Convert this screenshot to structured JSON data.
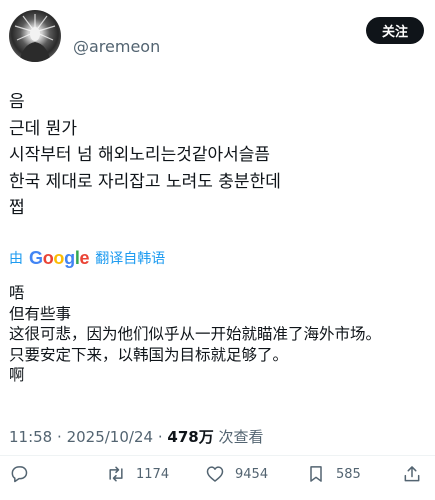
{
  "header": {
    "handle": "@aremeon",
    "follow_label": "关注"
  },
  "original": {
    "lines": [
      "음",
      "근데 뭔가",
      "시작부터 넘 해외노리는것같아서슬픔",
      "한국 제대로 자리잡고 노려도 충분한데",
      "쩝"
    ]
  },
  "translation": {
    "by_label": "由",
    "provider": "Google",
    "action_label": "翻译自韩语",
    "lines": [
      "唔",
      "但有些事",
      "这很可悲，因为他们似乎从一开始就瞄准了海外市场。",
      "只要安定下来，以韩国为目标就足够了。",
      "啊"
    ]
  },
  "meta": {
    "time": "11:58",
    "date": "2025/10/24",
    "separator": "·",
    "views_count": "478万",
    "views_label": "次查看"
  },
  "actions": {
    "reply_icon": "reply-icon",
    "retweet_count": "1174",
    "like_count": "9454",
    "bookmark_count": "585"
  },
  "colors": {
    "text": "#0f1419",
    "secondary": "#536471",
    "link": "#1d9bf0",
    "button_bg": "#0f1419"
  }
}
